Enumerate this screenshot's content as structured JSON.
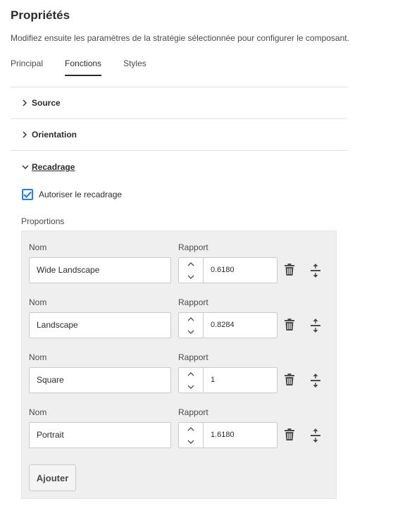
{
  "header": {
    "title": "Propriétés",
    "description": "Modifiez ensuite les paramètres de la stratégie sélectionnée pour configurer le composant."
  },
  "tabs": [
    {
      "label": "Principal",
      "active": false
    },
    {
      "label": "Fonctions",
      "active": true
    },
    {
      "label": "Styles",
      "active": false
    }
  ],
  "sections": {
    "source": {
      "label": "Source",
      "expanded": false
    },
    "orientation": {
      "label": "Orientation",
      "expanded": false
    },
    "recadrage": {
      "label": "Recadrage",
      "expanded": true
    }
  },
  "crop": {
    "allow_label": "Autoriser le recadrage",
    "allow_checked": true,
    "proportions_label": "Proportions",
    "name_label": "Nom",
    "ratio_label": "Rapport",
    "rows": [
      {
        "name": "Wide Landscape",
        "ratio": "0.6180"
      },
      {
        "name": "Landscape",
        "ratio": "0.8284"
      },
      {
        "name": "Square",
        "ratio": "1"
      },
      {
        "name": "Portrait",
        "ratio": "1.6180"
      }
    ],
    "add_label": "Ajouter"
  },
  "icons": {
    "chevron_right": "chevron-right-icon",
    "chevron_down": "chevron-down-icon",
    "checkmark": "checkmark-icon",
    "step_up": "chevron-up-icon",
    "step_down": "chevron-down-icon",
    "delete": "trash-icon",
    "reorder": "move-handle-icon"
  },
  "colors": {
    "accent": "#2680eb",
    "panel_bg": "#efefef",
    "text": "#2c2c2c",
    "divider": "#e1e1e1"
  }
}
